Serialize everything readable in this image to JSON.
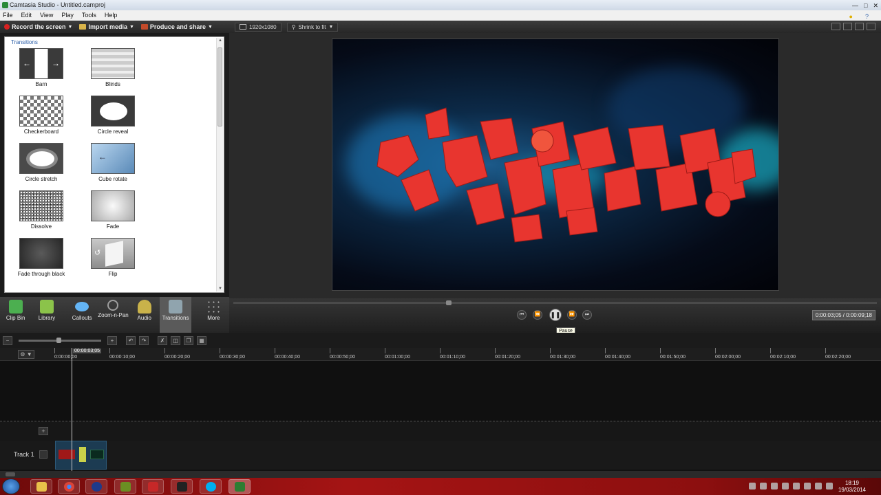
{
  "window": {
    "title": "Camtasia Studio - Untitled.camproj"
  },
  "menu": [
    "File",
    "Edit",
    "View",
    "Play",
    "Tools",
    "Help"
  ],
  "left_toolbar": {
    "record_label": "Record the screen",
    "import_label": "Import media",
    "produce_label": "Produce and share"
  },
  "preview_toolbar": {
    "dimensions": "1920x1080",
    "zoom": "Shrink to fit"
  },
  "transitions": {
    "title": "Transitions",
    "items": [
      {
        "label": "Barn"
      },
      {
        "label": "Blinds"
      },
      {
        "label": "Checkerboard"
      },
      {
        "label": "Circle reveal"
      },
      {
        "label": "Circle stretch"
      },
      {
        "label": "Cube rotate"
      },
      {
        "label": "Dissolve"
      },
      {
        "label": "Fade"
      },
      {
        "label": "Fade through black"
      },
      {
        "label": "Flip"
      }
    ]
  },
  "tabs": [
    {
      "label": "Clip Bin",
      "icon": "clip-bin-icon",
      "color": "#4caf50"
    },
    {
      "label": "Library",
      "icon": "library-icon",
      "color": "#8bc34a"
    },
    {
      "label": "Callouts",
      "icon": "callouts-icon",
      "color": "#64b5f6"
    },
    {
      "label": "Zoom-n-Pan",
      "icon": "zoom-icon",
      "color": "#9e9e9e"
    },
    {
      "label": "Audio",
      "icon": "speaker-icon",
      "color": "#c9b24a"
    },
    {
      "label": "Transitions",
      "icon": "transitions-icon",
      "color": "#90a4ae"
    },
    {
      "label": "More",
      "icon": "more-icon",
      "color": "#bdbdbd"
    }
  ],
  "playback": {
    "tooltip": "Pause",
    "timecode": "0:00:03;05 / 0:00:09;18",
    "progress": 0.33
  },
  "timeline": {
    "playhead_label": "00:00:03;05",
    "ruler": [
      "0:00:00;00",
      "00:00:10;00",
      "00:00:20;00",
      "00:00:30;00",
      "00:00:40;00",
      "00:00:50;00",
      "00:01:00;00",
      "00:01:10;00",
      "00:01:20;00",
      "00:01:30;00",
      "00:01:40;00",
      "00:01:50;00",
      "00:02:00;00",
      "00:02:10;00",
      "00:02:20;00"
    ],
    "track_label": "Track 1"
  },
  "taskbar": {
    "time": "18:19",
    "date": "19/03/2014"
  },
  "colors": {
    "accent": "#2b5ea8",
    "recording": "#d82020",
    "taskbar": "#a51414"
  }
}
